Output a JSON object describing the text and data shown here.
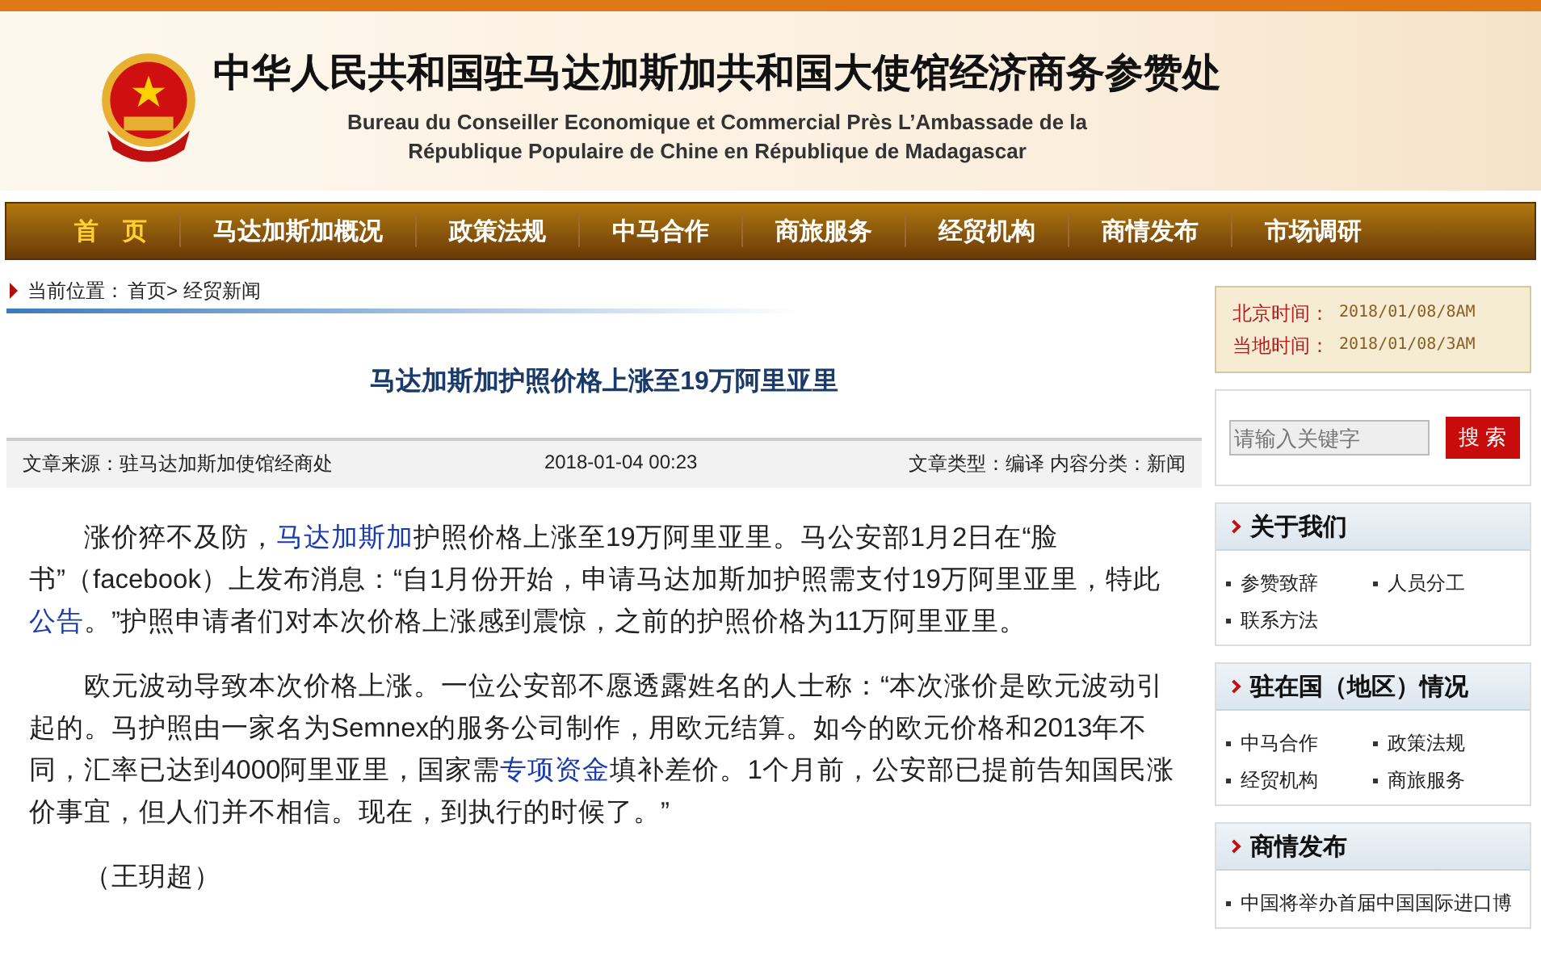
{
  "header": {
    "title": "中华人民共和国驻马达加斯加共和国大使馆经济商务参赞处",
    "subtitle_lines": [
      "Bureau du Conseiller Economique et Commercial Près L’Ambassade de la",
      "République Populaire de Chine en République de Madagascar"
    ]
  },
  "nav": [
    {
      "label": "首　页",
      "selected": true
    },
    {
      "label": "马达加斯加概况",
      "selected": false
    },
    {
      "label": "政策法规",
      "selected": false
    },
    {
      "label": "中马合作",
      "selected": false
    },
    {
      "label": "商旅服务",
      "selected": false
    },
    {
      "label": "经贸机构",
      "selected": false
    },
    {
      "label": "商情发布",
      "selected": false
    },
    {
      "label": "市场调研",
      "selected": false
    }
  ],
  "breadcrumb": {
    "label": "当前位置：",
    "path": "首页> 经贸新闻"
  },
  "article": {
    "title": "马达加斯加护照价格上涨至19万阿里亚里",
    "source": "文章来源：驻马达加斯加使馆经商处",
    "date": "2018-01-04 00:23",
    "meta": "文章类型：编译 内容分类：新闻",
    "paragraphs": [
      [
        {
          "text": "涨价猝不及防，",
          "kind": "text"
        },
        {
          "text": "马达加斯加",
          "kind": "link"
        },
        {
          "text": "护照价格上涨至19万阿里亚里。马公安部1月2日在“脸书”（facebook）上发布消息：“自1月份开始，申请马达加斯加护照需支付19万阿里亚里，特此",
          "kind": "text"
        },
        {
          "text": "公告",
          "kind": "link"
        },
        {
          "text": "。”护照申请者们对本次价格上涨感到震惊，之前的护照价格为11万阿里亚里。",
          "kind": "text"
        }
      ],
      [
        {
          "text": "欧元波动导致本次价格上涨。一位公安部不愿透露姓名的人士称：“本次涨价是欧元波动引起的。马护照由一家名为Semnex的服务公司制作，用欧元结算。如今的欧元价格和2013年不同，汇率已达到4000阿里亚里，国家需",
          "kind": "text"
        },
        {
          "text": "专项资金",
          "kind": "link"
        },
        {
          "text": "填补差价。1个月前，公安部已提前告知国民涨价事宜，但人们并不相信。现在，到执行的时候了。”",
          "kind": "text"
        }
      ],
      [
        {
          "text": "（王玥超）",
          "kind": "text"
        }
      ]
    ]
  },
  "sidebar": {
    "times": [
      {
        "label": "北京时间：",
        "value": "2018/01/08/8AM"
      },
      {
        "label": "当地时间：",
        "value": "2018/01/08/3AM"
      }
    ],
    "search": {
      "placeholder": "请输入关键字",
      "button": "搜 索"
    },
    "sections": [
      {
        "title": "关于我们",
        "items": [
          "参赞致辞",
          "人员分工",
          "联系方法"
        ]
      },
      {
        "title": "驻在国（地区）情况",
        "items": [
          "中马合作",
          "政策法规",
          "经贸机构",
          "商旅服务"
        ]
      },
      {
        "title": "商情发布",
        "items": [
          "中国将举办首届中国国际进口博"
        ]
      }
    ]
  }
}
